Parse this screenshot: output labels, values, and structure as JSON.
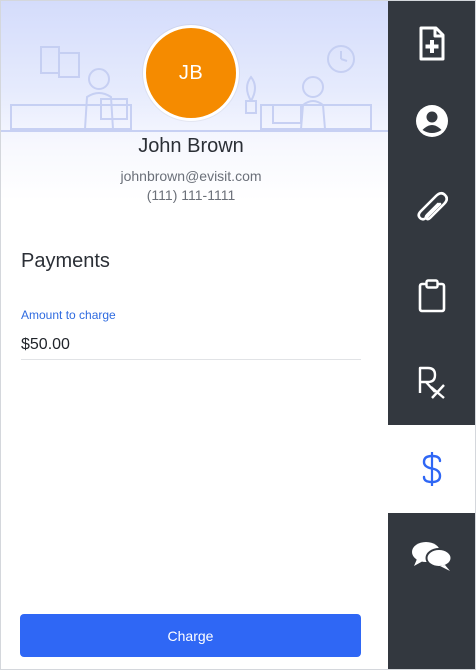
{
  "profile": {
    "initials": "JB",
    "name": "John Brown",
    "email": "johnbrown@evisit.com",
    "phone": "(111) 111-1111"
  },
  "payments": {
    "title": "Payments",
    "amount_label": "Amount to charge",
    "amount_value": "$50.00",
    "charge_label": "Charge"
  },
  "sidebar": {
    "items": [
      {
        "icon": "medical-file-icon",
        "active": false
      },
      {
        "icon": "user-circle-icon",
        "active": false
      },
      {
        "icon": "paperclip-icon",
        "active": false
      },
      {
        "icon": "clipboard-icon",
        "active": false
      },
      {
        "icon": "prescription-icon",
        "active": false
      },
      {
        "icon": "dollar-icon",
        "active": true
      },
      {
        "icon": "chat-bubbles-icon",
        "active": false
      }
    ]
  },
  "colors": {
    "accent": "#2f67f5",
    "avatar": "#f58b00",
    "sidebar": "#33383f"
  }
}
